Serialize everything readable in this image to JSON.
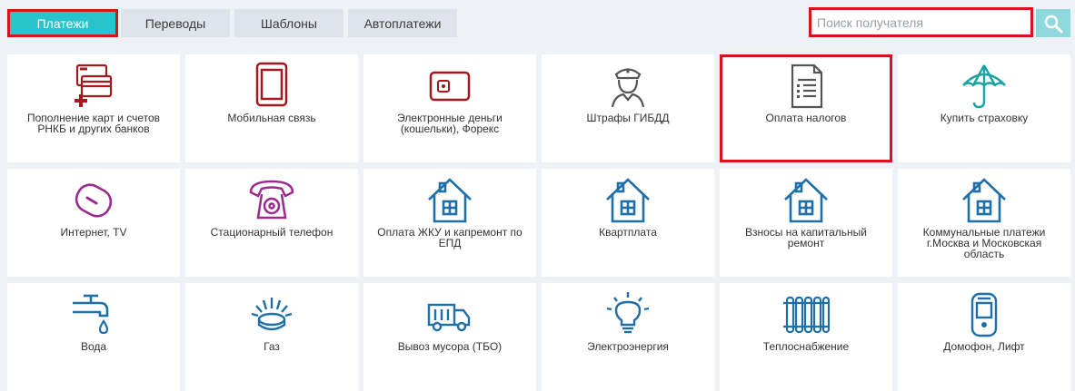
{
  "tabs": [
    {
      "label": "Платежи",
      "active": true
    },
    {
      "label": "Переводы"
    },
    {
      "label": "Шаблоны"
    },
    {
      "label": "Автоплатежи"
    }
  ],
  "search": {
    "placeholder": "Поиск получателя",
    "value": ""
  },
  "colors": {
    "accent": "#29c3cc",
    "highlight": "#d7141a",
    "red_icon": "#a3191f",
    "blue_icon": "#1e6fa8",
    "purple_icon": "#9b2a8f"
  },
  "tiles": [
    {
      "label": "Пополнение карт и счетов РНКБ и других банков",
      "icon": "cards-plus-icon"
    },
    {
      "label": "Мобильная связь",
      "icon": "mobile-phone-icon"
    },
    {
      "label": "Электронные деньги (кошельки), Форекс",
      "icon": "wallet-icon"
    },
    {
      "label": "Штрафы ГИБДД",
      "icon": "traffic-police-icon"
    },
    {
      "label": "Оплата налогов",
      "icon": "tax-document-icon"
    },
    {
      "label": "Купить страховку",
      "icon": "umbrella-icon"
    },
    {
      "label": "Интернет, TV",
      "icon": "router-icon"
    },
    {
      "label": "Стационарный телефон",
      "icon": "landline-phone-icon"
    },
    {
      "label": "Оплата ЖКУ и капремонт по ЕПД",
      "icon": "house-icon"
    },
    {
      "label": "Квартплата",
      "icon": "house-icon"
    },
    {
      "label": "Взносы на капитальный ремонт",
      "icon": "house-icon"
    },
    {
      "label": "Коммунальные платежи г.Москва и Московская область",
      "icon": "house-icon"
    },
    {
      "label": "Вода",
      "icon": "water-tap-icon"
    },
    {
      "label": "Газ",
      "icon": "gas-burner-icon"
    },
    {
      "label": "Вывоз мусора (ТБО)",
      "icon": "garbage-truck-icon"
    },
    {
      "label": "Электроэнергия",
      "icon": "light-bulb-icon"
    },
    {
      "label": "Теплоснабжение",
      "icon": "radiator-icon"
    },
    {
      "label": "Домофон, Лифт",
      "icon": "intercom-icon"
    }
  ]
}
